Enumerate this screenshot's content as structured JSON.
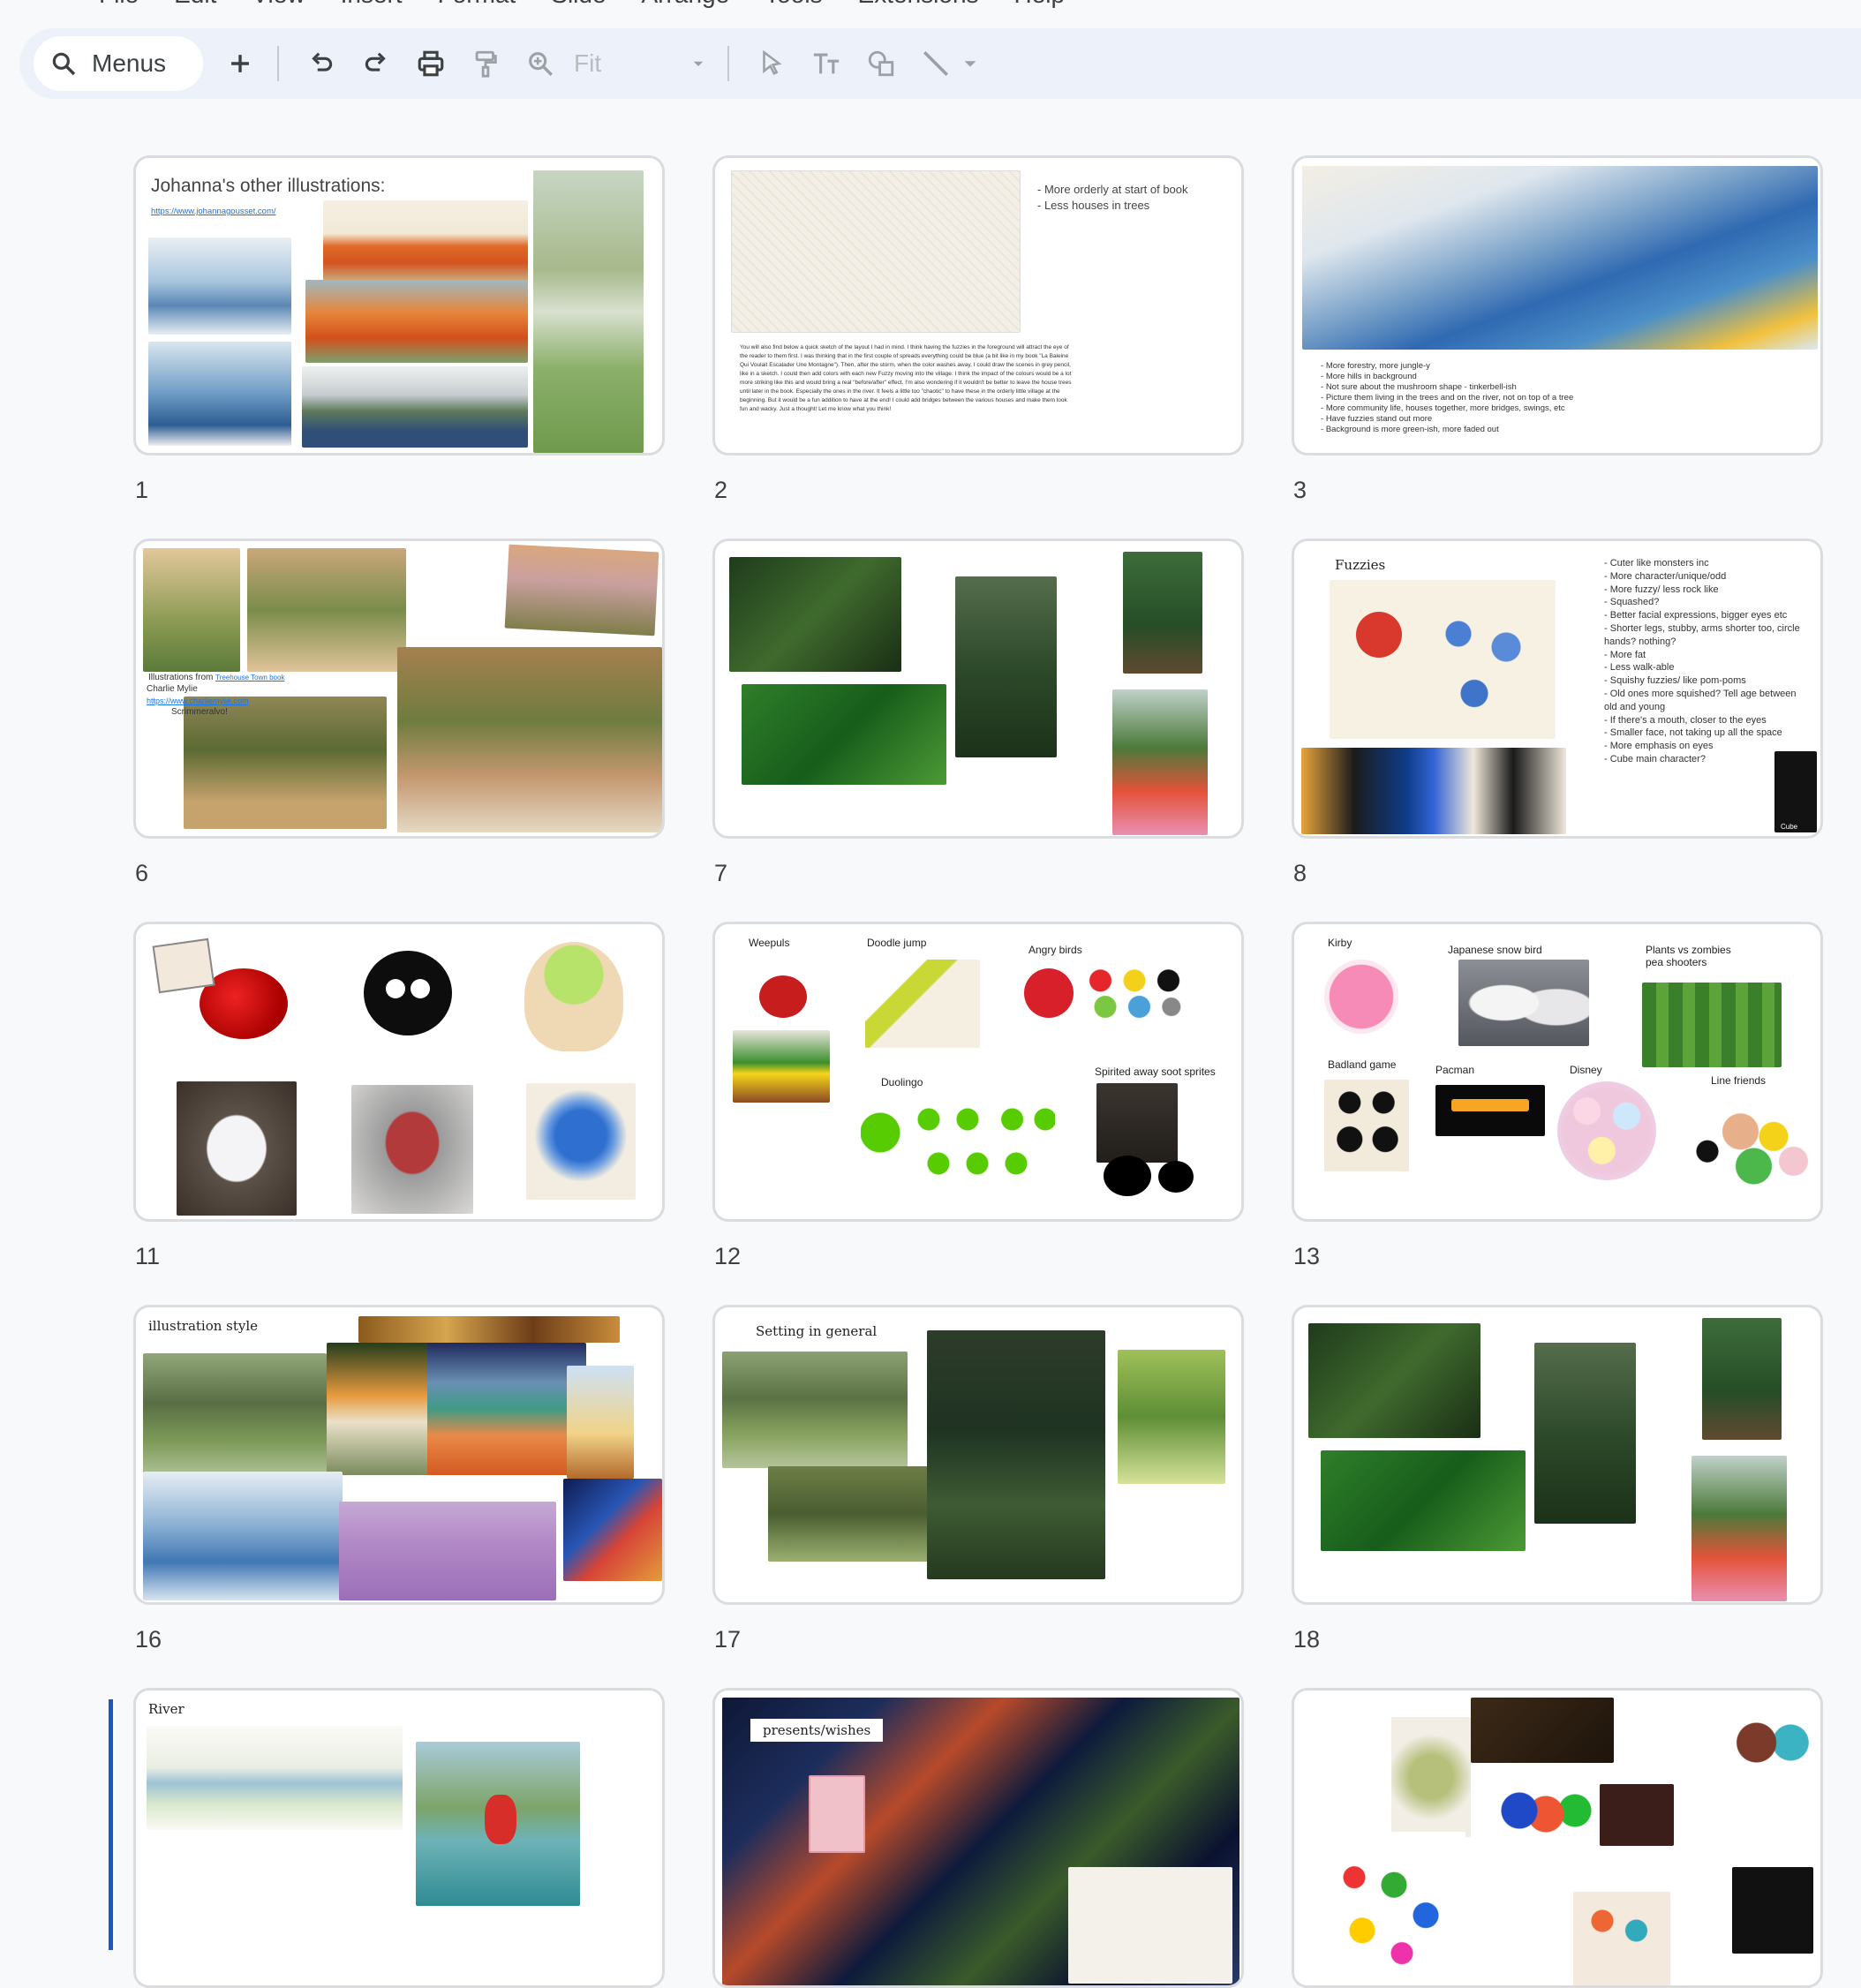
{
  "menubar": [
    "File",
    "Edit",
    "View",
    "Insert",
    "Format",
    "Slide",
    "Arrange",
    "Tools",
    "Extensions",
    "Help"
  ],
  "toolbar": {
    "search_label": "Menus",
    "zoom_value": "Fit",
    "icons": [
      "search-icon",
      "add-icon",
      "undo-icon",
      "redo-icon",
      "print-icon",
      "paint-format-icon",
      "zoom-icon",
      "select-icon",
      "text-box-icon",
      "shape-icon",
      "line-icon"
    ]
  },
  "slides": [
    {
      "number": "1",
      "title": "Johanna's other illustrations:",
      "link": "https://www.johannagousset.com/"
    },
    {
      "number": "2",
      "notes": [
        "- More orderly at start of book",
        "- Less houses in trees"
      ],
      "body": "You will also find below a quick sketch of the layout I had in mind. I think having the fuzzies in the foreground will attract the eye of the reader to them first. I was thinking that in the first couple of spreads everything could be blue (a bit like in my book \"La Baleine Qui Voulait Escalader Une Montagne\"). Then, after the storm, when the color washes away, I could draw the scenes in grey pencil, like in a sketch. I could then add colors with each new Fuzzy moving into the village. I think the impact of the colours would be a lot more striking like this and would bring a real \"before/after\" effect. I'm also wondering if it wouldn't be better to leave the house trees until later in the book. Especially the ones in the river. It feels a little too \"chaotic\" to have these in the orderly little village at the beginning. But it would be a fun addition to have at the end! I could add bridges between the various houses and make them look fun and wacky. Just a thought! Let me know what you think!"
    },
    {
      "number": "3",
      "notes": [
        "More forestry, more jungle-y",
        "More hills in background",
        "Not sure about the mushroom shape - tinkerbell-ish",
        "Picture them living in the trees and on the river, not on top of a tree",
        "More community life, houses together, more bridges, swings, etc",
        "Have fuzzies stand out more",
        "Background is more green-ish, more faded out"
      ]
    },
    {
      "number": "6",
      "caption": "Illustrations from",
      "caption_link": "Treehouse Town book",
      "author": "Charlie Mylie",
      "author_link": "https://www.charliemylie.com",
      "bullet": "Scrimmeralvo!"
    },
    {
      "number": "7"
    },
    {
      "number": "8",
      "title": "Fuzzies",
      "cube_label": "Cube",
      "notes": [
        "Cuter like monsters inc",
        "More character/unique/odd",
        "More fuzzy/ less rock like",
        "Squashed?",
        "Better facial expressions, bigger eyes etc",
        "Shorter legs, stubby, arms shorter too, circle hands? nothing?",
        "More fat",
        "Less walk-able",
        "Squishy fuzzies/ like pom-poms",
        "Old ones more squished? Tell age between old and young",
        "If there's a mouth, closer to the eyes",
        "Smaller face, not taking up all the space",
        "More emphasis on eyes",
        "Cube main character?"
      ]
    },
    {
      "number": "11"
    },
    {
      "number": "12",
      "labels": [
        "Weepuls",
        "Doodle jump",
        "Angry birds",
        "Duolingo",
        "Spirited away soot sprites"
      ]
    },
    {
      "number": "13",
      "labels": [
        "Kirby",
        "Japanese snow bird",
        "Plants vs zombies pea shooters",
        "Badland game",
        "Pacman",
        "Disney",
        "Line friends"
      ]
    },
    {
      "number": "16",
      "title": "illustration style"
    },
    {
      "number": "17",
      "title": "Setting in general"
    },
    {
      "number": "18"
    },
    {
      "number": "",
      "title": "River"
    },
    {
      "number": "",
      "title": "presents/wishes"
    },
    {
      "number": ""
    }
  ],
  "colors": {
    "accent": "#1a73e8",
    "toolbar_bg": "#edf2fa",
    "selection": "#1a57c2"
  }
}
